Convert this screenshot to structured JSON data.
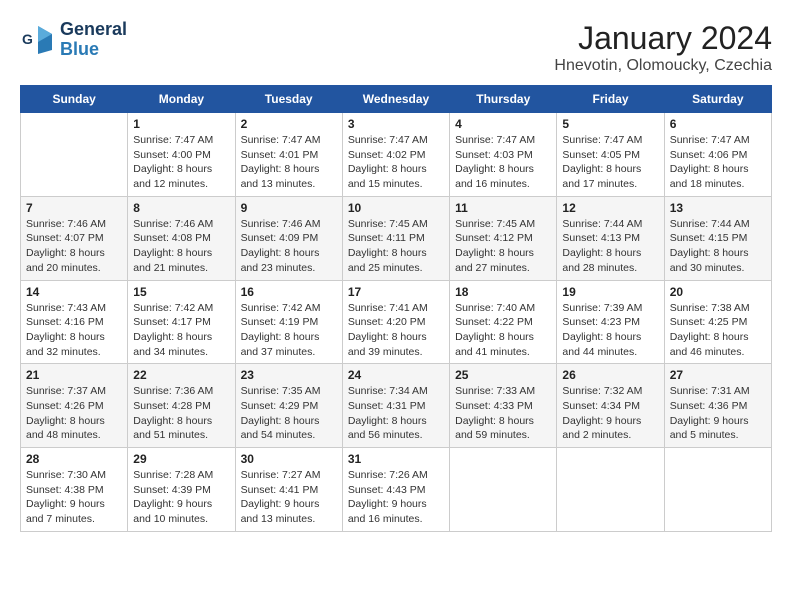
{
  "header": {
    "title": "January 2024",
    "subtitle": "Hnevotin, Olomoucky, Czechia",
    "logo_general": "General",
    "logo_blue": "Blue"
  },
  "weekdays": [
    "Sunday",
    "Monday",
    "Tuesday",
    "Wednesday",
    "Thursday",
    "Friday",
    "Saturday"
  ],
  "weeks": [
    [
      {
        "day": null
      },
      {
        "day": 1,
        "sunrise": "7:47 AM",
        "sunset": "4:00 PM",
        "daylight": "8 hours and 12 minutes."
      },
      {
        "day": 2,
        "sunrise": "7:47 AM",
        "sunset": "4:01 PM",
        "daylight": "8 hours and 13 minutes."
      },
      {
        "day": 3,
        "sunrise": "7:47 AM",
        "sunset": "4:02 PM",
        "daylight": "8 hours and 15 minutes."
      },
      {
        "day": 4,
        "sunrise": "7:47 AM",
        "sunset": "4:03 PM",
        "daylight": "8 hours and 16 minutes."
      },
      {
        "day": 5,
        "sunrise": "7:47 AM",
        "sunset": "4:05 PM",
        "daylight": "8 hours and 17 minutes."
      },
      {
        "day": 6,
        "sunrise": "7:47 AM",
        "sunset": "4:06 PM",
        "daylight": "8 hours and 18 minutes."
      }
    ],
    [
      {
        "day": 7,
        "sunrise": "7:46 AM",
        "sunset": "4:07 PM",
        "daylight": "8 hours and 20 minutes."
      },
      {
        "day": 8,
        "sunrise": "7:46 AM",
        "sunset": "4:08 PM",
        "daylight": "8 hours and 21 minutes."
      },
      {
        "day": 9,
        "sunrise": "7:46 AM",
        "sunset": "4:09 PM",
        "daylight": "8 hours and 23 minutes."
      },
      {
        "day": 10,
        "sunrise": "7:45 AM",
        "sunset": "4:11 PM",
        "daylight": "8 hours and 25 minutes."
      },
      {
        "day": 11,
        "sunrise": "7:45 AM",
        "sunset": "4:12 PM",
        "daylight": "8 hours and 27 minutes."
      },
      {
        "day": 12,
        "sunrise": "7:44 AM",
        "sunset": "4:13 PM",
        "daylight": "8 hours and 28 minutes."
      },
      {
        "day": 13,
        "sunrise": "7:44 AM",
        "sunset": "4:15 PM",
        "daylight": "8 hours and 30 minutes."
      }
    ],
    [
      {
        "day": 14,
        "sunrise": "7:43 AM",
        "sunset": "4:16 PM",
        "daylight": "8 hours and 32 minutes."
      },
      {
        "day": 15,
        "sunrise": "7:42 AM",
        "sunset": "4:17 PM",
        "daylight": "8 hours and 34 minutes."
      },
      {
        "day": 16,
        "sunrise": "7:42 AM",
        "sunset": "4:19 PM",
        "daylight": "8 hours and 37 minutes."
      },
      {
        "day": 17,
        "sunrise": "7:41 AM",
        "sunset": "4:20 PM",
        "daylight": "8 hours and 39 minutes."
      },
      {
        "day": 18,
        "sunrise": "7:40 AM",
        "sunset": "4:22 PM",
        "daylight": "8 hours and 41 minutes."
      },
      {
        "day": 19,
        "sunrise": "7:39 AM",
        "sunset": "4:23 PM",
        "daylight": "8 hours and 44 minutes."
      },
      {
        "day": 20,
        "sunrise": "7:38 AM",
        "sunset": "4:25 PM",
        "daylight": "8 hours and 46 minutes."
      }
    ],
    [
      {
        "day": 21,
        "sunrise": "7:37 AM",
        "sunset": "4:26 PM",
        "daylight": "8 hours and 48 minutes."
      },
      {
        "day": 22,
        "sunrise": "7:36 AM",
        "sunset": "4:28 PM",
        "daylight": "8 hours and 51 minutes."
      },
      {
        "day": 23,
        "sunrise": "7:35 AM",
        "sunset": "4:29 PM",
        "daylight": "8 hours and 54 minutes."
      },
      {
        "day": 24,
        "sunrise": "7:34 AM",
        "sunset": "4:31 PM",
        "daylight": "8 hours and 56 minutes."
      },
      {
        "day": 25,
        "sunrise": "7:33 AM",
        "sunset": "4:33 PM",
        "daylight": "8 hours and 59 minutes."
      },
      {
        "day": 26,
        "sunrise": "7:32 AM",
        "sunset": "4:34 PM",
        "daylight": "9 hours and 2 minutes."
      },
      {
        "day": 27,
        "sunrise": "7:31 AM",
        "sunset": "4:36 PM",
        "daylight": "9 hours and 5 minutes."
      }
    ],
    [
      {
        "day": 28,
        "sunrise": "7:30 AM",
        "sunset": "4:38 PM",
        "daylight": "9 hours and 7 minutes."
      },
      {
        "day": 29,
        "sunrise": "7:28 AM",
        "sunset": "4:39 PM",
        "daylight": "9 hours and 10 minutes."
      },
      {
        "day": 30,
        "sunrise": "7:27 AM",
        "sunset": "4:41 PM",
        "daylight": "9 hours and 13 minutes."
      },
      {
        "day": 31,
        "sunrise": "7:26 AM",
        "sunset": "4:43 PM",
        "daylight": "9 hours and 16 minutes."
      },
      {
        "day": null
      },
      {
        "day": null
      },
      {
        "day": null
      }
    ]
  ]
}
